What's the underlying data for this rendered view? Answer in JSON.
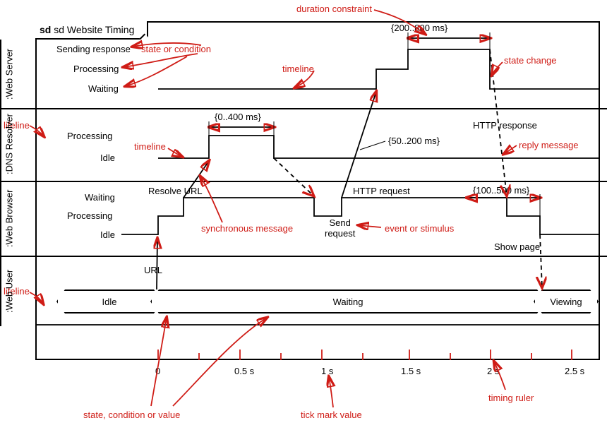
{
  "frame": {
    "name": "sd Website Timing"
  },
  "lifelines": {
    "webServer": ":Web Server",
    "dnsResolver": ":DNS Resolver",
    "webBrowser": ":Web Browser",
    "webUser": ":Web User"
  },
  "states": {
    "webServer": [
      "Sending response",
      "Processing",
      "Waiting"
    ],
    "dnsResolver": [
      "Processing",
      "Idle"
    ],
    "webBrowser": [
      "Waiting",
      "Processing",
      "Idle"
    ],
    "webUser": [
      "Idle",
      "Waiting",
      "Viewing"
    ]
  },
  "messages": {
    "resolve": "Resolve URL",
    "http_request": "HTTP request",
    "http_response": "HTTP response",
    "url": "URL",
    "send_request_l1": "Send",
    "send_request_l2": "request",
    "show_page": "Show page"
  },
  "durations": {
    "d1": "{200..800 ms}",
    "d2": "{0..400 ms}",
    "d3": "{50..200 ms}",
    "d4": "{100..500 ms}"
  },
  "ticks": [
    "0",
    "0.5 s",
    "1 s",
    "1.5 s",
    "2 s",
    "2.5 s"
  ],
  "labels": {
    "duration_constraint": "duration constraint",
    "state_or_condition": "state or condition",
    "timeline": "timeline",
    "state_change": "state change",
    "lifeline": "lifeline",
    "reply_message": "reply message",
    "synchronous_message": "synchronous message",
    "event_or_stimulus": "event or stimulus",
    "state_condition_or_value": "state, condition or value",
    "tick_mark_value": "tick mark value",
    "timing_ruler": "timing ruler"
  },
  "chart_data": {
    "type": "timing",
    "time_axis": {
      "unit": "s",
      "start": -0.25,
      "end": 2.8,
      "major_ticks": [
        0,
        0.5,
        1.0,
        1.5,
        2.0,
        2.5
      ]
    },
    "lifelines": [
      {
        "name": ":Web Server",
        "states_top_to_bottom": [
          "Sending response",
          "Processing",
          "Waiting"
        ],
        "segments": [
          {
            "state": "Waiting",
            "t0": 0.0,
            "t1": 1.3
          },
          {
            "state": "Processing",
            "t0": 1.3,
            "t1": 1.5
          },
          {
            "state": "Sending response",
            "t0": 1.5,
            "t1": 2.0
          },
          {
            "state": "Waiting",
            "t0": 2.0,
            "t1": 2.8
          }
        ]
      },
      {
        "name": ":DNS Resolver",
        "states_top_to_bottom": [
          "Processing",
          "Idle"
        ],
        "segments": [
          {
            "state": "Idle",
            "t0": 0.0,
            "t1": 0.3
          },
          {
            "state": "Processing",
            "t0": 0.3,
            "t1": 0.7
          },
          {
            "state": "Idle",
            "t0": 0.7,
            "t1": 2.8
          }
        ]
      },
      {
        "name": ":Web Browser",
        "states_top_to_bottom": [
          "Waiting",
          "Processing",
          "Idle"
        ],
        "segments": [
          {
            "state": "Idle",
            "t0": -0.25,
            "t1": 0.0
          },
          {
            "state": "Processing",
            "t0": 0.0,
            "t1": 0.15
          },
          {
            "state": "Waiting",
            "t0": 0.15,
            "t1": 0.95
          },
          {
            "state": "Processing",
            "t0": 0.95,
            "t1": 1.1
          },
          {
            "state": "Waiting",
            "t0": 1.1,
            "t1": 2.1
          },
          {
            "state": "Processing",
            "t0": 2.1,
            "t1": 2.35
          },
          {
            "state": "Idle",
            "t0": 2.35,
            "t1": 2.8
          }
        ]
      },
      {
        "name": ":Web User",
        "states_top_to_bottom": [
          "Idle",
          "Waiting",
          "Viewing"
        ],
        "segments": [
          {
            "state": "Idle",
            "t0": -0.25,
            "t1": 0.0
          },
          {
            "state": "Waiting",
            "t0": 0.0,
            "t1": 2.35
          },
          {
            "state": "Viewing",
            "t0": 2.35,
            "t1": 2.8
          }
        ]
      }
    ],
    "messages": [
      {
        "name": "URL",
        "from": ":Web User",
        "to": ":Web Browser",
        "t": 0.0,
        "type": "sync"
      },
      {
        "name": "Resolve URL",
        "from": ":Web Browser",
        "to": ":DNS Resolver",
        "t_from": 0.15,
        "t_to": 0.3,
        "type": "sync"
      },
      {
        "name": "(reply)",
        "from": ":DNS Resolver",
        "to": ":Web Browser",
        "t_from": 0.7,
        "t_to": 0.95,
        "type": "reply"
      },
      {
        "name": "HTTP request",
        "from": ":Web Browser",
        "to": ":Web Server",
        "t_from": 1.1,
        "t_to": 1.3,
        "type": "sync"
      },
      {
        "name": "HTTP response",
        "from": ":Web Server",
        "to": ":Web Browser",
        "t_from": 2.0,
        "t_to": 2.1,
        "type": "reply"
      },
      {
        "name": "Show page",
        "from": ":Web Browser",
        "to": ":Web User",
        "t": 2.35,
        "type": "reply"
      }
    ],
    "duration_constraints": [
      {
        "text": "{0..400 ms}",
        "lifeline": ":DNS Resolver",
        "t0": 0.3,
        "t1": 0.7
      },
      {
        "text": "{50..200 ms}",
        "message": "HTTP request"
      },
      {
        "text": "{200..800 ms}",
        "lifeline": ":Web Server",
        "state": "Sending response",
        "t0": 1.5,
        "t1": 2.0
      },
      {
        "text": "{100..500 ms}",
        "lifeline": ":Web Browser",
        "t0": 2.1,
        "t1": 2.35
      }
    ]
  }
}
